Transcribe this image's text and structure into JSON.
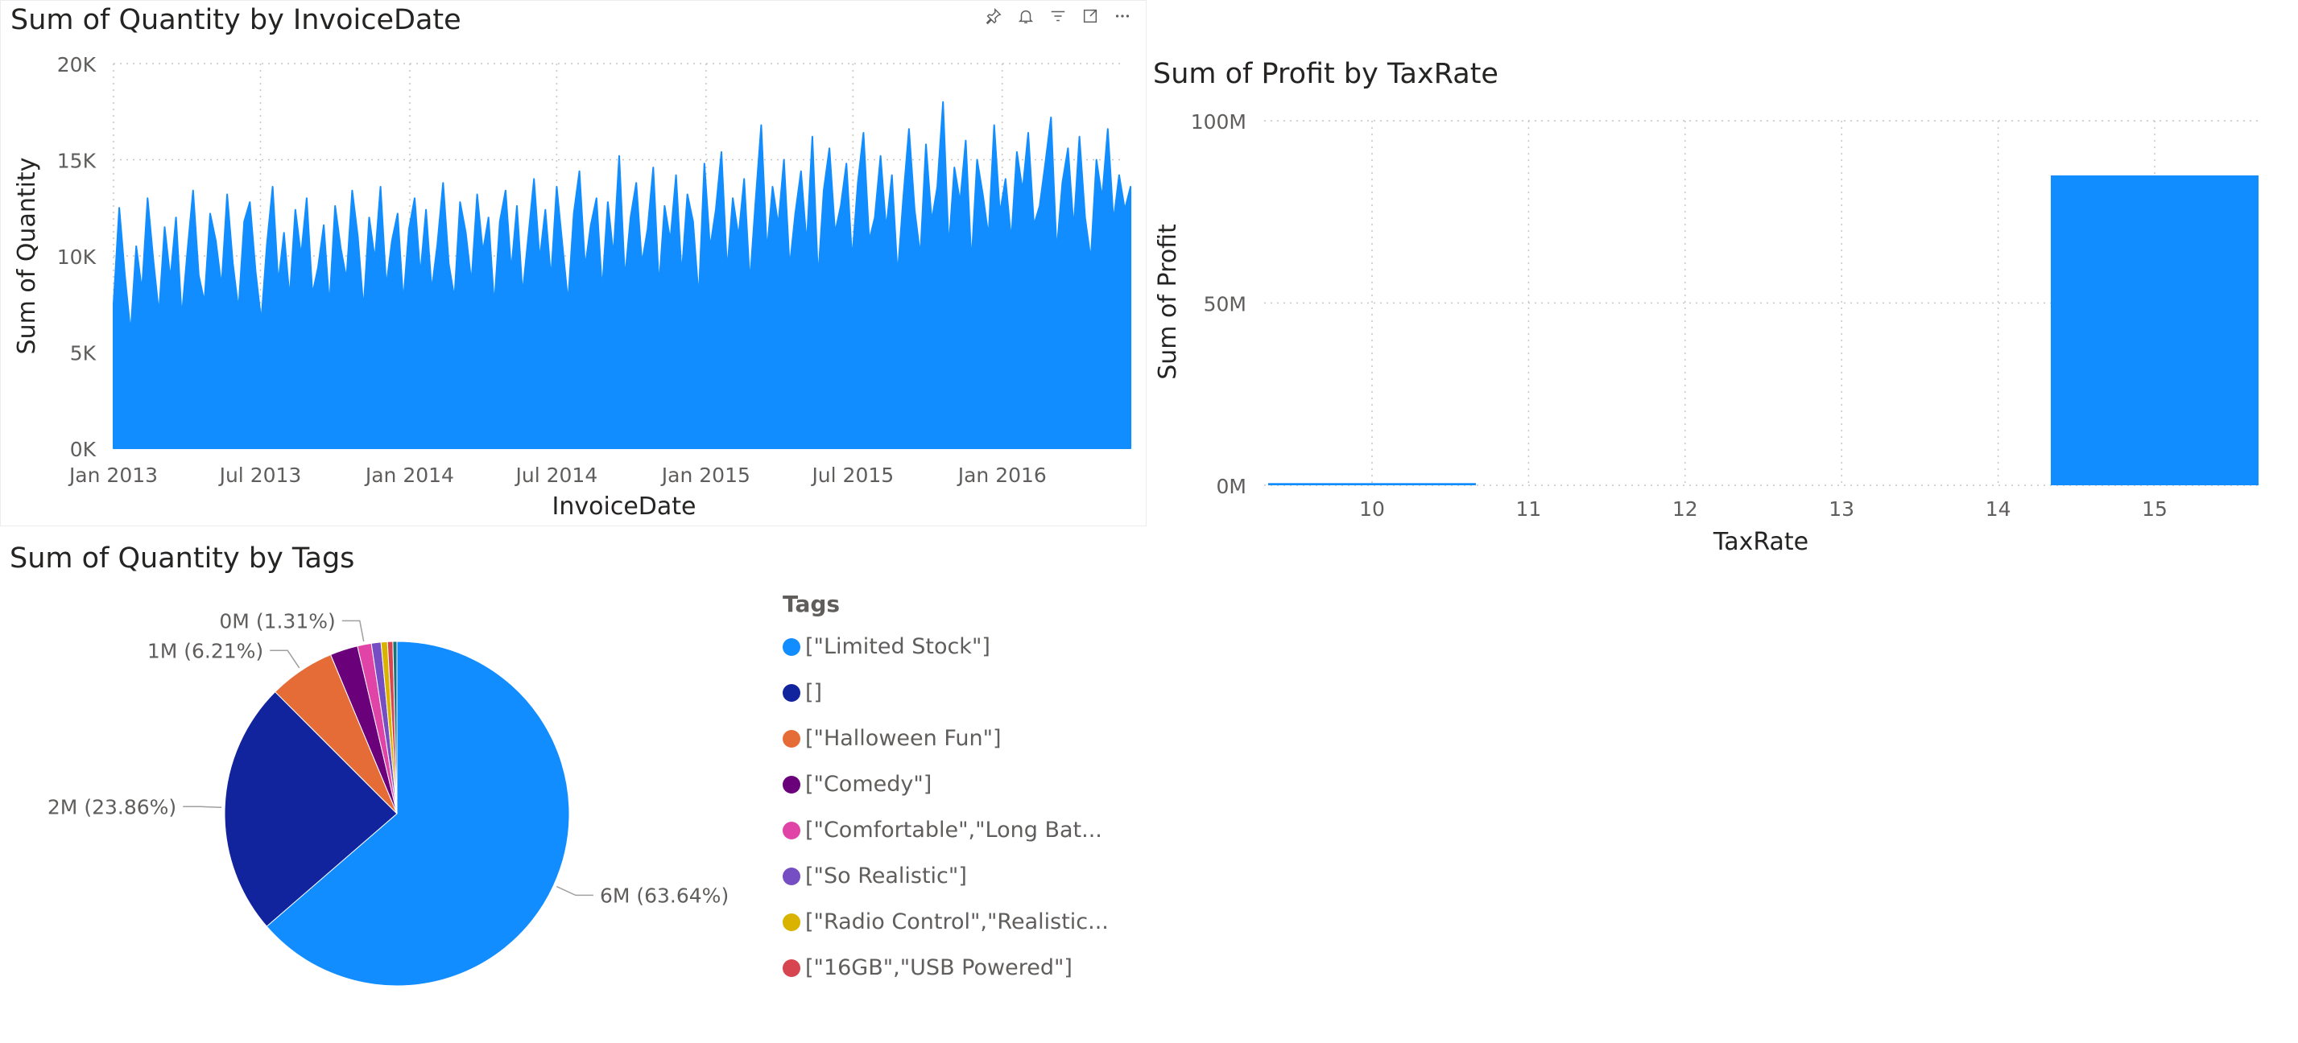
{
  "visuals": {
    "line": {
      "title": "Sum of Quantity by InvoiceDate",
      "header_icons": [
        "pin-icon",
        "bell-icon",
        "filter-icon",
        "focus-mode-icon",
        "more-options-icon"
      ]
    },
    "bar": {
      "title": "Sum of Profit by TaxRate"
    },
    "pie": {
      "title": "Sum of Quantity by Tags"
    }
  },
  "colors": {
    "primary": "#118DFF",
    "grid": "#C8C6C4",
    "axis_text": "#605E5C",
    "title_text": "#252423"
  },
  "chart_data": [
    {
      "type": "area",
      "title": "Sum of Quantity by InvoiceDate",
      "xlabel": "InvoiceDate",
      "ylabel": "Sum of Quantity",
      "x_ticks": [
        "Jan 2013",
        "Jul 2013",
        "Jan 2014",
        "Jul 2014",
        "Jan 2015",
        "Jul 2015",
        "Jan 2016"
      ],
      "y_ticks": [
        "0K",
        "5K",
        "10K",
        "15K",
        "20K"
      ],
      "ylim": [
        0,
        20000
      ],
      "x_range": [
        "2013-01-01",
        "2016-05-31"
      ],
      "series": [
        {
          "x_start": "2013-01-01",
          "x_step_days": 7,
          "values": [
            7500,
            12500,
            9000,
            6000,
            10500,
            8200,
            13000,
            9800,
            7000,
            11500,
            8800,
            12000,
            6800,
            10200,
            13400,
            9000,
            7600,
            12200,
            10800,
            8400,
            13200,
            9600,
            7200,
            11800,
            12800,
            9200,
            6600,
            10600,
            13600,
            8600,
            11200,
            7800,
            12400,
            10000,
            13000,
            8000,
            9400,
            11600,
            7400,
            12600,
            10400,
            8800,
            13400,
            11000,
            7200,
            12000,
            9800,
            13600,
            8400,
            10800,
            12200,
            7600,
            11400,
            13000,
            9000,
            12400,
            8200,
            10600,
            13800,
            9600,
            7800,
            12800,
            11200,
            8600,
            13200,
            10200,
            12000,
            7400,
            11800,
            13400,
            9200,
            12600,
            8000,
            11000,
            14000,
            9800,
            12400,
            8800,
            13600,
            10600,
            7600,
            12200,
            14400,
            9400,
            11600,
            13000,
            8200,
            12800,
            10000,
            15200,
            8800,
            12000,
            13800,
            9600,
            11400,
            14600,
            8400,
            12600,
            10800,
            14200,
            9000,
            13200,
            11800,
            7800,
            14800,
            10400,
            12400,
            15400,
            9200,
            13000,
            11000,
            14000,
            8600,
            12800,
            16800,
            10200,
            13600,
            11600,
            15000,
            9400,
            12200,
            14400,
            10600,
            16200,
            8800,
            13400,
            15600,
            11200,
            12600,
            14800,
            9800,
            13800,
            16400,
            10800,
            12000,
            15200,
            11400,
            14200,
            9000,
            13000,
            16600,
            12400,
            10000,
            15800,
            11800,
            13600,
            18000,
            10400,
            14600,
            12800,
            16000,
            9600,
            15000,
            13200,
            11000,
            16800,
            12200,
            14000,
            10800,
            15400,
            13400,
            16400,
            11600,
            12600,
            14800,
            17200,
            10200,
            13800,
            15600,
            11400,
            16200,
            12000,
            9800,
            15000,
            13000,
            16600,
            11800,
            14200,
            12400,
            13600
          ]
        }
      ]
    },
    {
      "type": "bar",
      "title": "Sum of Profit by TaxRate",
      "xlabel": "TaxRate",
      "ylabel": "Sum of Profit",
      "categories": [
        "10",
        "11",
        "12",
        "13",
        "14",
        "15"
      ],
      "values": [
        0.6,
        0,
        0,
        0,
        0,
        85
      ],
      "value_unit": "M",
      "y_ticks": [
        "0M",
        "50M",
        "100M"
      ],
      "ylim": [
        0,
        100
      ]
    },
    {
      "type": "pie",
      "title": "Sum of Quantity by Tags",
      "legend_title": "Tags",
      "legend_position": "right",
      "slices": [
        {
          "label": "[\"Limited Stock\"]",
          "value": 63.64,
          "color": "#118DFF",
          "data_label": "6M (63.64%)"
        },
        {
          "label": "[]",
          "value": 23.86,
          "color": "#12239E",
          "data_label": "2M (23.86%)"
        },
        {
          "label": "[\"Halloween Fun\"]",
          "value": 6.21,
          "color": "#E66C37",
          "data_label": "1M (6.21%)"
        },
        {
          "label": "[\"Comedy\"]",
          "value": 2.6,
          "color": "#6B007B",
          "data_label": ""
        },
        {
          "label": "[\"Comfortable\",\"Long Bat...",
          "value": 1.31,
          "color": "#E044A7",
          "data_label": "0M (1.31%)"
        },
        {
          "label": "[\"So Realistic\"]",
          "value": 0.9,
          "color": "#744EC2",
          "data_label": ""
        },
        {
          "label": "[\"Radio Control\",\"Realistic...",
          "value": 0.6,
          "color": "#D9B300",
          "data_label": ""
        },
        {
          "label": "[\"16GB\",\"USB Powered\"]",
          "value": 0.5,
          "color": "#D64550",
          "data_label": ""
        },
        {
          "label": "",
          "value": 0.38,
          "color": "#197278",
          "data_label": ""
        }
      ]
    }
  ]
}
